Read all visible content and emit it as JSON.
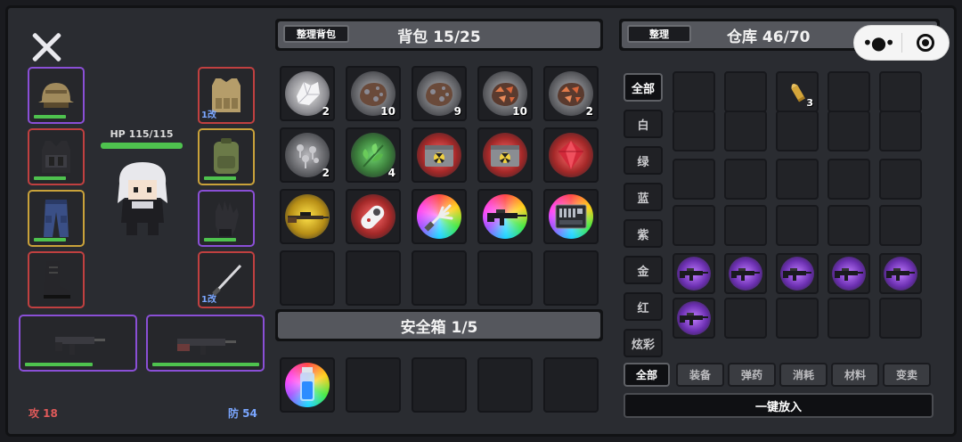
{
  "character": {
    "hp_text": "HP 115/115",
    "hp_fraction": 1.0,
    "attack_text": "攻 18",
    "defense_text": "防 54"
  },
  "equipment": {
    "helmet": {
      "icon": "helmet-icon",
      "durability": 1.0
    },
    "armor_vest": {
      "icon": "armor-vest-icon",
      "level": "1改",
      "durability": 1.0
    },
    "tactical_vest": {
      "icon": "tactical-vest-icon",
      "durability": 1.0
    },
    "backpack": {
      "icon": "backpack-icon",
      "durability": 1.0
    },
    "pants": {
      "icon": "pants-icon",
      "durability": 1.0
    },
    "gloves": {
      "icon": "gloves-icon",
      "durability": 1.0
    },
    "boots": {
      "icon": "boots-icon",
      "durability": 1.0
    },
    "melee": {
      "icon": "blade-icon",
      "level": "1改",
      "durability": 1.0
    },
    "primary_weapon": {
      "icon": "smg-icon",
      "durability": 1.0
    },
    "secondary_weapon": {
      "icon": "rifle-icon",
      "durability": 1.0
    }
  },
  "backpack": {
    "sort_button": "整理背包",
    "title": "背包 15/25",
    "items": [
      {
        "icon": "white-crystal-icon",
        "rarity": "white",
        "count": "2"
      },
      {
        "icon": "iron-ore-icon",
        "rarity": "grey",
        "count": "10"
      },
      {
        "icon": "iron-ore-icon",
        "rarity": "grey",
        "count": "9"
      },
      {
        "icon": "copper-ore-icon",
        "rarity": "grey",
        "count": "10"
      },
      {
        "icon": "copper-ore-icon",
        "rarity": "grey",
        "count": "2"
      },
      {
        "icon": "screws-icon",
        "rarity": "grey",
        "count": "2"
      },
      {
        "icon": "herb-icon",
        "rarity": "green",
        "count": "4"
      },
      {
        "icon": "radioactive-case-icon",
        "rarity": "red",
        "count": ""
      },
      {
        "icon": "radioactive-case-icon",
        "rarity": "red",
        "count": ""
      },
      {
        "icon": "red-gem-icon",
        "rarity": "red",
        "count": ""
      },
      {
        "icon": "sniper-rifle-icon",
        "rarity": "gold",
        "count": ""
      },
      {
        "icon": "scanner-icon",
        "rarity": "red",
        "count": ""
      },
      {
        "icon": "multitool-icon",
        "rarity": "rainbow",
        "count": ""
      },
      {
        "icon": "assault-rifle-icon",
        "rarity": "rainbow",
        "count": ""
      },
      {
        "icon": "toolbox-icon",
        "rarity": "rainbow",
        "count": ""
      }
    ]
  },
  "safebox": {
    "title": "安全箱 1/5",
    "items": [
      {
        "icon": "serum-vial-icon",
        "rarity": "rainbow"
      }
    ]
  },
  "warehouse": {
    "sort_button": "整理",
    "title": "仓库 46/70",
    "filters": [
      "全部",
      "白",
      "绿",
      "蓝",
      "紫",
      "金",
      "红",
      "炫彩"
    ],
    "category_tabs": [
      "全部",
      "装备",
      "弹药",
      "消耗",
      "材料",
      "变卖"
    ],
    "put_all_button": "一键放入",
    "bullet_count": "3"
  },
  "colors": {
    "purple": "#8a4fd6",
    "red": "#c04040",
    "gold": "#c9a23a",
    "green": "#4ec24e",
    "blue_text": "#7aa6ff"
  }
}
